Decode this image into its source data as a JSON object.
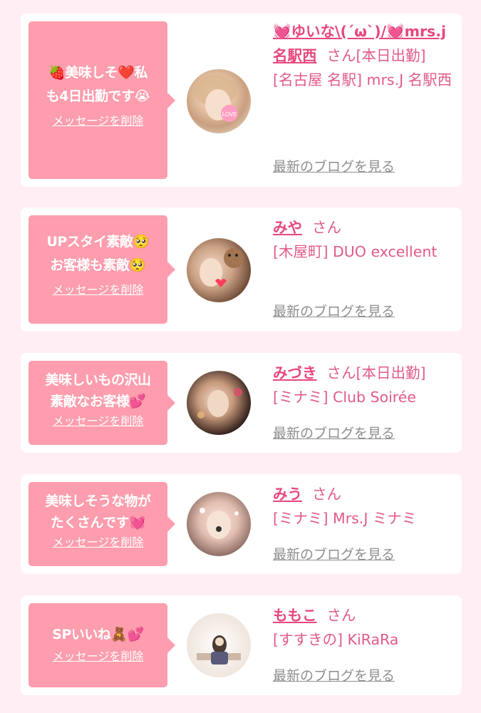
{
  "messages": [
    {
      "bubble_lines": [
        "🍓美味しそ❤️私",
        "も4日出勤です😭"
      ],
      "delete_label": "メッセージを削除",
      "name": "💓ゆいな\\(´ω`)/💓mrs.j名駅西",
      "honorific": "さん",
      "status": "[本日出勤]",
      "shop": "[名古屋 名駅] mrs.J 名駅西",
      "blog_label": "最新のブログを見る"
    },
    {
      "bubble_lines": [
        "UPスタイ素敵🥺",
        "お客様も素敵🥺"
      ],
      "delete_label": "メッセージを削除",
      "name": "みや",
      "honorific": "さん",
      "status": "",
      "shop": "[木屋町] DUO excellent",
      "blog_label": "最新のブログを見る"
    },
    {
      "bubble_lines": [
        "美味しいもの沢山",
        "素敵なお客様💕"
      ],
      "delete_label": "メッセージを削除",
      "name": "みづき",
      "honorific": "さん",
      "status": "[本日出勤]",
      "shop": "[ミナミ] Club Soirée",
      "blog_label": "最新のブログを見る"
    },
    {
      "bubble_lines": [
        "美味しそうな物が",
        "たくさんです💓"
      ],
      "delete_label": "メッセージを削除",
      "name": "みう",
      "honorific": "さん",
      "status": "",
      "shop": "[ミナミ] Mrs.J ミナミ",
      "blog_label": "最新のブログを見る"
    },
    {
      "bubble_lines": [
        "SPいいね🧸💕"
      ],
      "delete_label": "メッセージを削除",
      "name": "ももこ",
      "honorific": "さん",
      "status": "",
      "shop": "[すすきの] KiRaRa",
      "blog_label": "最新のブログを見る"
    }
  ],
  "colors": {
    "background": "#ffeef3",
    "bubble": "#fd9dad",
    "name": "#e6477c",
    "shop_text": "#e25a86",
    "blog_link": "#8e8e8e"
  }
}
